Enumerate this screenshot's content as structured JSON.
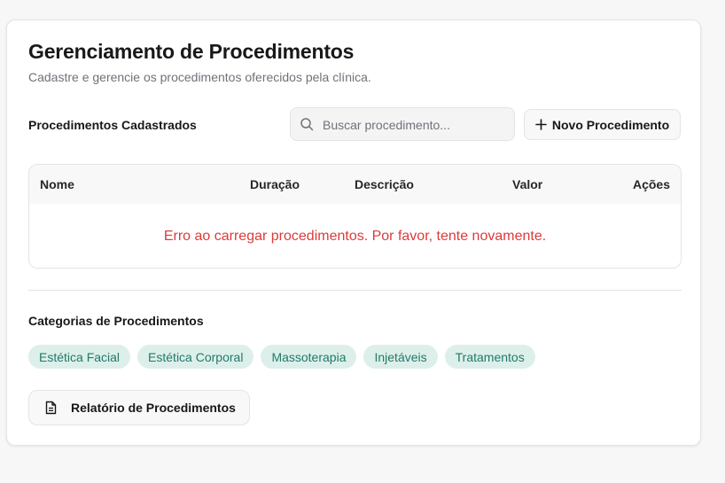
{
  "header": {
    "title": "Gerenciamento de Procedimentos",
    "subtitle": "Cadastre e gerencie os procedimentos oferecidos pela clínica."
  },
  "procedures": {
    "section_label": "Procedimentos Cadastrados",
    "search_placeholder": "Buscar procedimento...",
    "search_value": "",
    "new_button_label": "Novo Procedimento",
    "columns": [
      "Nome",
      "Duração",
      "Descrição",
      "Valor",
      "Ações"
    ],
    "error_message": "Erro ao carregar procedimentos. Por favor, tente novamente."
  },
  "categories": {
    "section_label": "Categorias de Procedimentos",
    "items": [
      "Estética Facial",
      "Estética Corporal",
      "Massoterapia",
      "Injetáveis",
      "Tratamentos"
    ]
  },
  "report": {
    "button_label": "Relatório de Procedimentos"
  },
  "icons": {
    "search": "search-icon",
    "plus": "plus-icon",
    "document": "document-icon"
  },
  "colors": {
    "error": "#dc3b3b",
    "chip_background": "#ddefea",
    "chip_text": "#217a68"
  }
}
